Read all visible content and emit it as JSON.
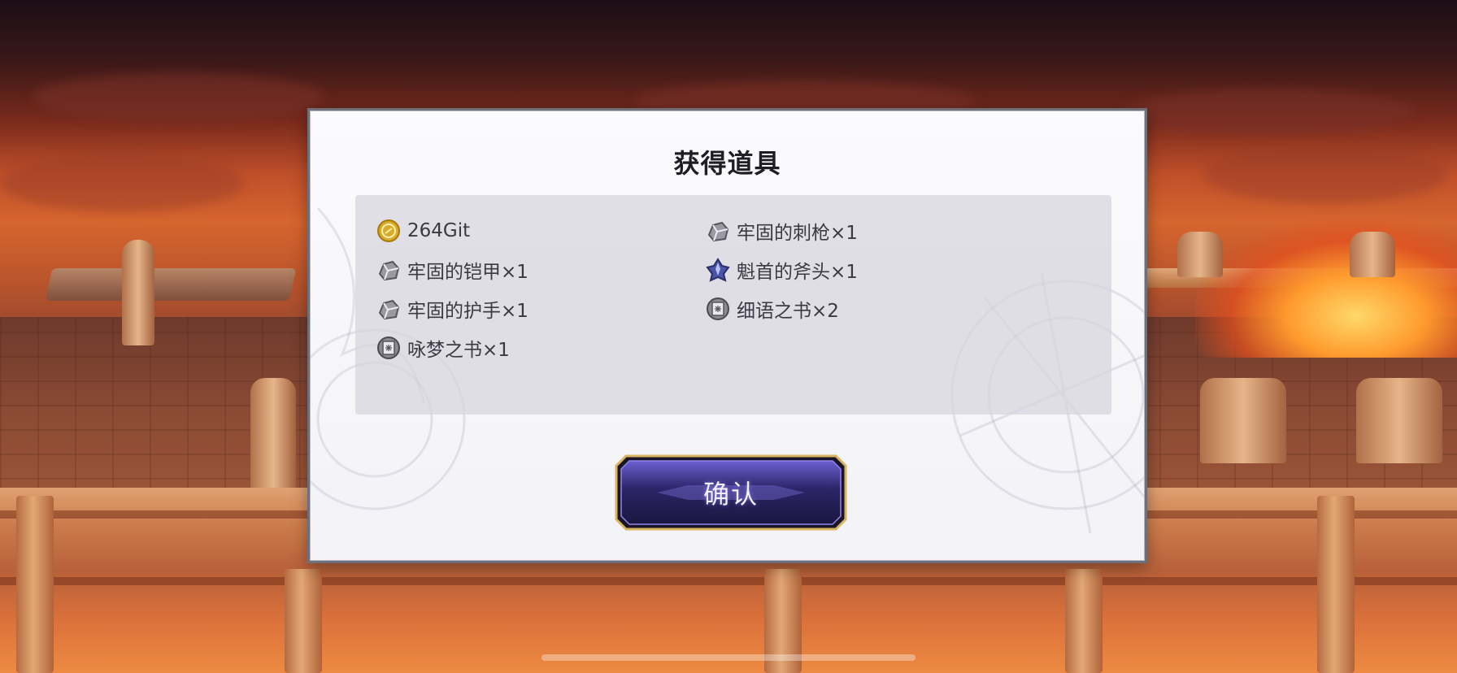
{
  "dialog": {
    "title": "获得道具",
    "confirm_label": "确认"
  },
  "items": [
    {
      "icon": "gold-coin-icon",
      "label": "264Git"
    },
    {
      "icon": "iron-ore-icon",
      "label": "牢固的刺枪×1"
    },
    {
      "icon": "iron-ore-icon",
      "label": "牢固的铠甲×1"
    },
    {
      "icon": "blue-crystal-icon",
      "label": "魁首的斧头×1"
    },
    {
      "icon": "iron-ore-icon",
      "label": "牢固的护手×1"
    },
    {
      "icon": "book-icon",
      "label": "细语之书×2"
    },
    {
      "icon": "book-icon",
      "label": "咏梦之书×1"
    }
  ],
  "colors": {
    "dialog_bg": "#fbfbfd",
    "panel_bg": "#d6d4dc",
    "button_accent": "#3b2f8a",
    "button_border": "#d9b460"
  }
}
